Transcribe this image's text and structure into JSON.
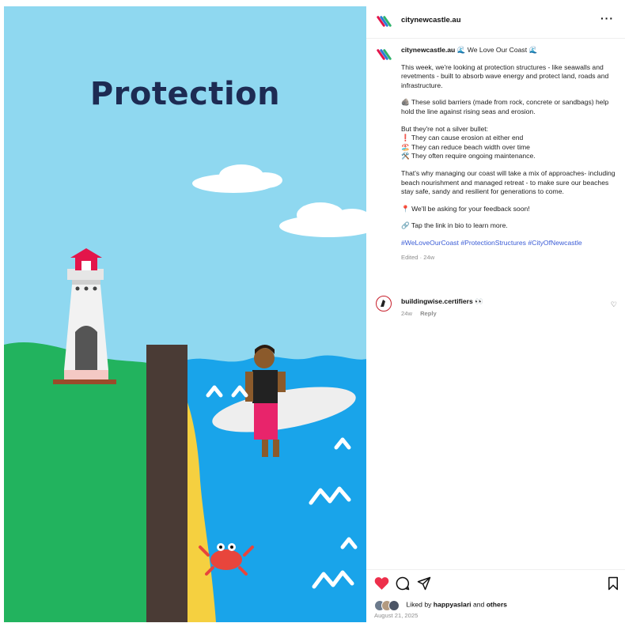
{
  "media": {
    "title": "Protection",
    "colors": {
      "sky": "#8fd8f0",
      "grass": "#22b35e",
      "sea": "#19a4ea",
      "sand": "#f5d040",
      "wall": "#4a3b35",
      "accent": "#e3154a"
    }
  },
  "post": {
    "account": "citynewcastle.au",
    "more_icon": "more-horizontal-icon",
    "caption": {
      "author": "citynewcastle.au",
      "title": "🌊 We Love Our Coast 🌊",
      "paragraphs": [
        "This week, we're looking at protection structures - like seawalls and revetments - built to absorb wave energy and protect land, roads and infrastructure.",
        "🪨 These solid barriers (made from rock, concrete or sandbags) help hold the line against rising seas and erosion.",
        "But they're not a silver bullet:\n❗ They can cause erosion at either end\n🏖️ They can reduce beach width over time\n🛠️ They often require ongoing maintenance.",
        "That's why managing our coast will take a mix of approaches- including beach nourishment and managed retreat - to make sure our beaches stay safe, sandy and resilient for generations to come.",
        "📍 We'll be asking for your feedback soon!",
        "🔗 Tap the link in bio to learn more."
      ],
      "hashtags": "#WeLoveOurCoast #ProtectionStructures #CityOfNewcastle",
      "edited": "Edited · 24w"
    },
    "comment": {
      "user": "buildingwise.certifiers",
      "emoji": "👀",
      "time": "24w",
      "reply": "Reply"
    },
    "actions": {
      "like_color": "#ed2f4b"
    },
    "likes": {
      "prefix": "Liked by",
      "user": "happyaslari",
      "mid": "and",
      "others": "others"
    },
    "date": "August 21, 2025"
  }
}
